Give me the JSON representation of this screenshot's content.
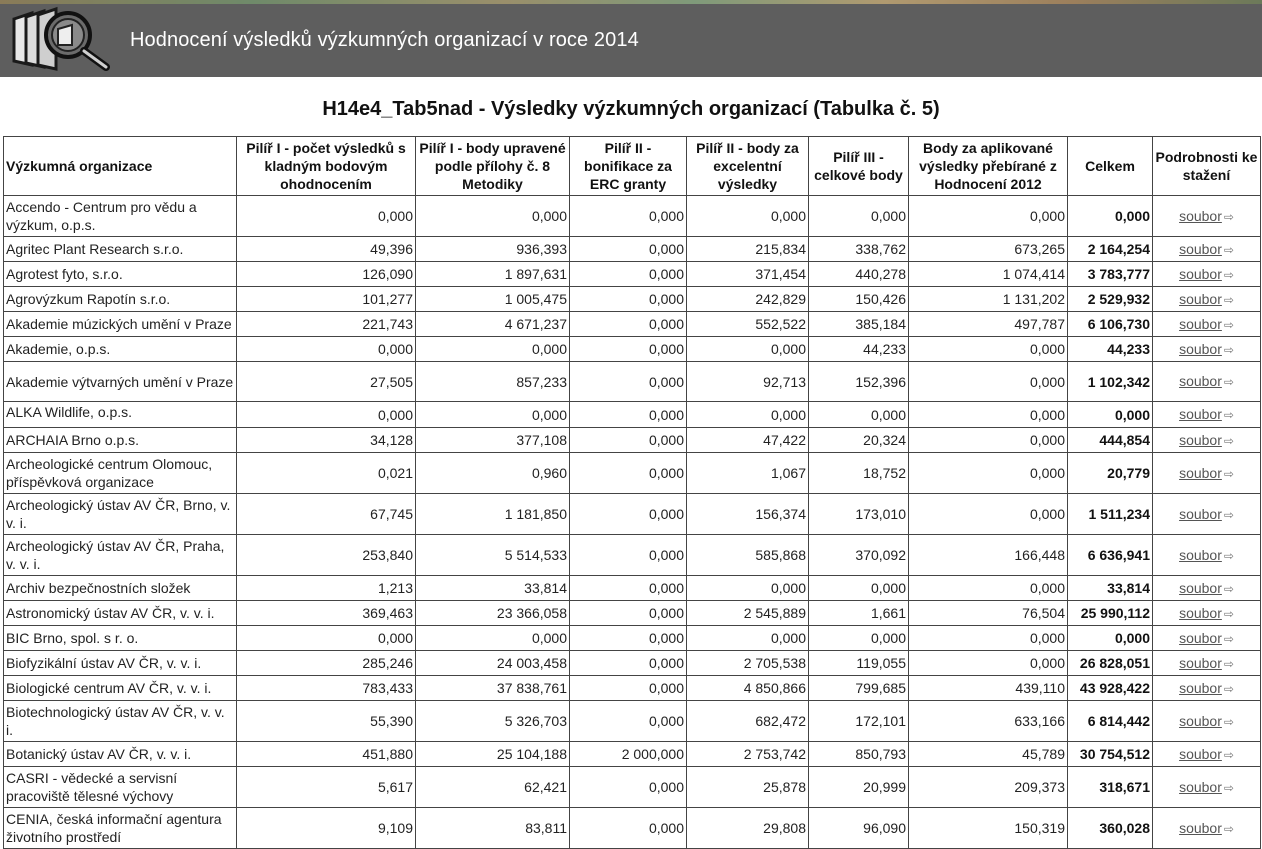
{
  "header": {
    "title": "Hodnocení výsledků výzkumných organizací v roce 2014",
    "logo_icon": "magnifier-folder-icon"
  },
  "page": {
    "title": "H14e4_Tab5nad - Výsledky výzkumných organizací (Tabulka č. 5)"
  },
  "table": {
    "columns": [
      "Výzkumná organizace",
      "Pilíř I - počet výsledků s kladným bodovým ohodnocením",
      "Pilíř I - body upravené podle přílohy č. 8 Metodiky",
      "Pilíř II - bonifikace za ERC granty",
      "Pilíř II - body za excelentní výsledky",
      "Pilíř III - celkové body",
      "Body za aplikované výsledky přebírané z Hodnocení 2012",
      "Celkem",
      "Podrobnosti ke stažení"
    ],
    "download_label": "soubor",
    "download_icon": "arrow-right-icon",
    "rows": [
      {
        "name": "Accendo - Centrum pro vědu a výzkum, o.p.s.",
        "p1count": "0,000",
        "p1body": "0,000",
        "p2erc": "0,000",
        "p2exc": "0,000",
        "p3": "0,000",
        "applied": "0,000",
        "total": "0,000"
      },
      {
        "name": "Agritec Plant Research s.r.o.",
        "p1count": "49,396",
        "p1body": "936,393",
        "p2erc": "0,000",
        "p2exc": "215,834",
        "p3": "338,762",
        "applied": "673,265",
        "total": "2 164,254"
      },
      {
        "name": "Agrotest fyto, s.r.o.",
        "p1count": "126,090",
        "p1body": "1 897,631",
        "p2erc": "0,000",
        "p2exc": "371,454",
        "p3": "440,278",
        "applied": "1 074,414",
        "total": "3 783,777"
      },
      {
        "name": "Agrovýzkum Rapotín s.r.o.",
        "p1count": "101,277",
        "p1body": "1 005,475",
        "p2erc": "0,000",
        "p2exc": "242,829",
        "p3": "150,426",
        "applied": "1 131,202",
        "total": "2 529,932"
      },
      {
        "name": "Akademie múzických umění v Praze",
        "p1count": "221,743",
        "p1body": "4 671,237",
        "p2erc": "0,000",
        "p2exc": "552,522",
        "p3": "385,184",
        "applied": "497,787",
        "total": "6 106,730"
      },
      {
        "name": "Akademie, o.p.s.",
        "p1count": "0,000",
        "p1body": "0,000",
        "p2erc": "0,000",
        "p2exc": "0,000",
        "p3": "44,233",
        "applied": "0,000",
        "total": "44,233"
      },
      {
        "name": "Akademie výtvarných umění v Praze",
        "p1count": "27,505",
        "p1body": "857,233",
        "p2erc": "0,000",
        "p2exc": "92,713",
        "p3": "152,396",
        "applied": "0,000",
        "total": "1 102,342"
      },
      {
        "name": "ALKA Wildlife, o.p.s.",
        "p1count": "0,000",
        "p1body": "0,000",
        "p2erc": "0,000",
        "p2exc": "0,000",
        "p3": "0,000",
        "applied": "0,000",
        "total": "0,000"
      },
      {
        "name": "ARCHAIA Brno o.p.s.",
        "p1count": "34,128",
        "p1body": "377,108",
        "p2erc": "0,000",
        "p2exc": "47,422",
        "p3": "20,324",
        "applied": "0,000",
        "total": "444,854"
      },
      {
        "name": "Archeologické centrum Olomouc, příspěvková organizace",
        "p1count": "0,021",
        "p1body": "0,960",
        "p2erc": "0,000",
        "p2exc": "1,067",
        "p3": "18,752",
        "applied": "0,000",
        "total": "20,779"
      },
      {
        "name": "Archeologický ústav AV ČR, Brno, v. v. i.",
        "p1count": "67,745",
        "p1body": "1 181,850",
        "p2erc": "0,000",
        "p2exc": "156,374",
        "p3": "173,010",
        "applied": "0,000",
        "total": "1 511,234"
      },
      {
        "name": "Archeologický ústav AV ČR, Praha, v. v. i.",
        "p1count": "253,840",
        "p1body": "5 514,533",
        "p2erc": "0,000",
        "p2exc": "585,868",
        "p3": "370,092",
        "applied": "166,448",
        "total": "6 636,941"
      },
      {
        "name": "Archiv bezpečnostních složek",
        "p1count": "1,213",
        "p1body": "33,814",
        "p2erc": "0,000",
        "p2exc": "0,000",
        "p3": "0,000",
        "applied": "0,000",
        "total": "33,814"
      },
      {
        "name": "Astronomický ústav AV ČR, v. v. i.",
        "p1count": "369,463",
        "p1body": "23 366,058",
        "p2erc": "0,000",
        "p2exc": "2 545,889",
        "p3": "1,661",
        "applied": "76,504",
        "total": "25 990,112"
      },
      {
        "name": "BIC Brno, spol. s r. o.",
        "p1count": "0,000",
        "p1body": "0,000",
        "p2erc": "0,000",
        "p2exc": "0,000",
        "p3": "0,000",
        "applied": "0,000",
        "total": "0,000"
      },
      {
        "name": "Biofyzikální ústav AV ČR, v. v. i.",
        "p1count": "285,246",
        "p1body": "24 003,458",
        "p2erc": "0,000",
        "p2exc": "2 705,538",
        "p3": "119,055",
        "applied": "0,000",
        "total": "26 828,051"
      },
      {
        "name": "Biologické centrum AV ČR, v. v. i.",
        "p1count": "783,433",
        "p1body": "37 838,761",
        "p2erc": "0,000",
        "p2exc": "4 850,866",
        "p3": "799,685",
        "applied": "439,110",
        "total": "43 928,422"
      },
      {
        "name": "Biotechnologický ústav AV ČR, v. v. i.",
        "p1count": "55,390",
        "p1body": "5 326,703",
        "p2erc": "0,000",
        "p2exc": "682,472",
        "p3": "172,101",
        "applied": "633,166",
        "total": "6 814,442"
      },
      {
        "name": "Botanický ústav AV ČR, v. v. i.",
        "p1count": "451,880",
        "p1body": "25 104,188",
        "p2erc": "2 000,000",
        "p2exc": "2 753,742",
        "p3": "850,793",
        "applied": "45,789",
        "total": "30 754,512"
      },
      {
        "name": "CASRI - vědecké a servisní pracoviště tělesné výchovy",
        "p1count": "5,617",
        "p1body": "62,421",
        "p2erc": "0,000",
        "p2exc": "25,878",
        "p3": "20,999",
        "applied": "209,373",
        "total": "318,671"
      },
      {
        "name": "CENIA, česká informační agentura životního prostředí",
        "p1count": "9,109",
        "p1body": "83,811",
        "p2erc": "0,000",
        "p2exc": "29,808",
        "p3": "96,090",
        "applied": "150,319",
        "total": "360,028"
      }
    ]
  }
}
